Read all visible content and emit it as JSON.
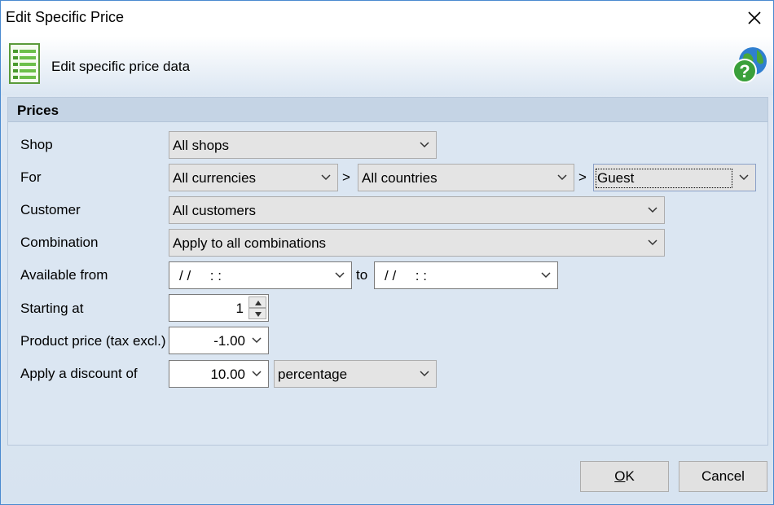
{
  "window": {
    "title": "Edit Specific Price",
    "header_text": "Edit specific price data"
  },
  "group": {
    "title": "Prices"
  },
  "labels": {
    "shop": "Shop",
    "for": "For",
    "customer": "Customer",
    "combination": "Combination",
    "available_from": "Available from",
    "starting_at": "Starting at",
    "product_price": "Product price (tax excl.)",
    "discount": "Apply a discount of"
  },
  "fields": {
    "shop": "All shops",
    "currency": "All currencies",
    "country": "All countries",
    "group": "Guest",
    "customer": "All customers",
    "combination": "Apply to all combinations",
    "from_date": "/ /     : :",
    "to_date": "/ /     : :",
    "starting_at": "1",
    "product_price": "-1.00",
    "discount_value": "10.00",
    "discount_type": "percentage"
  },
  "separators": {
    "gt1": ">",
    "gt2": ">",
    "to": "to"
  },
  "buttons": {
    "ok_prefix": "",
    "ok_mnemonic": "O",
    "ok_rest": "K",
    "cancel": "Cancel"
  },
  "colors": {
    "accent_border": "#4a8ad0",
    "group_header": "#c5d4e5",
    "panel_bg": "#dbe6f2"
  },
  "icons": {
    "header": "document-list-icon",
    "help": "help-globe-icon",
    "close": "close-icon"
  }
}
